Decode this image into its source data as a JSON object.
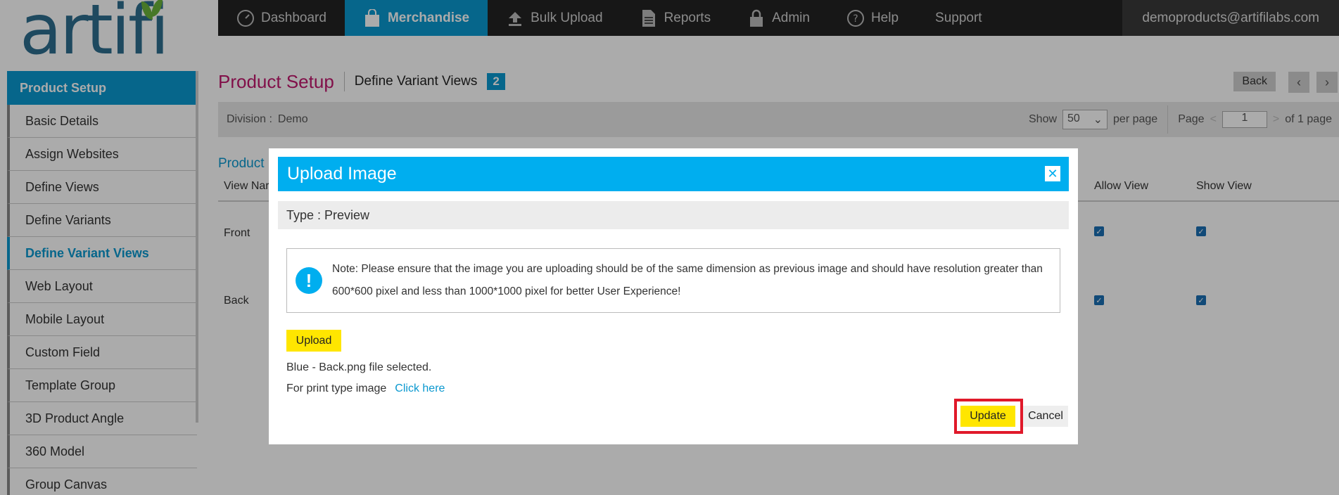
{
  "logo": {
    "text": "artifi"
  },
  "nav": {
    "items": [
      {
        "label": "Dashboard",
        "icon": "dashboard-gauge-icon"
      },
      {
        "label": "Merchandise",
        "icon": "shopping-bag-icon",
        "active": true
      },
      {
        "label": "Bulk Upload",
        "icon": "upload-arrow-icon"
      },
      {
        "label": "Reports",
        "icon": "document-icon"
      },
      {
        "label": "Admin",
        "icon": "lock-icon"
      },
      {
        "label": "Help",
        "icon": "question-icon"
      },
      {
        "label": "Support",
        "icon": ""
      }
    ],
    "user_email": "demoproducts@artifilabs.com"
  },
  "sidebar": {
    "header": "Product Setup",
    "items": [
      {
        "label": "Basic Details"
      },
      {
        "label": "Assign Websites"
      },
      {
        "label": "Define Views"
      },
      {
        "label": "Define Variants"
      },
      {
        "label": "Define Variant Views",
        "active": true
      },
      {
        "label": "Web Layout"
      },
      {
        "label": "Mobile Layout"
      },
      {
        "label": "Custom Field"
      },
      {
        "label": "Template Group"
      },
      {
        "label": "3D Product Angle"
      },
      {
        "label": "360 Model"
      },
      {
        "label": "Group Canvas"
      }
    ]
  },
  "main": {
    "title": "Product Setup",
    "subtitle": "Define Variant Views",
    "count": "2",
    "back_label": "Back",
    "division_label": "Division :",
    "division_value": "Demo",
    "show_label": "Show",
    "show_value": "50",
    "per_page_label": "per page",
    "page_label": "Page",
    "page_value": "1",
    "of_pages": "of 1 page",
    "section_label": "Product I",
    "columns": {
      "view_name": "View Nar",
      "allow_view": "Allow View",
      "show_view": "Show View"
    },
    "rows": [
      {
        "view": "Front",
        "allow": true,
        "show": true
      },
      {
        "view": "Back",
        "allow": true,
        "show": true
      }
    ]
  },
  "modal": {
    "title": "Upload Image",
    "type_label": "Type : Preview",
    "note": "Note: Please ensure that the image you are uploading should be of the same dimension as previous image and should have resolution greater than 600*600 pixel and less than 1000*1000 pixel for better User Experience!",
    "upload_label": "Upload",
    "file_selected": "Blue - Back.png file selected.",
    "print_type_label": "For print type image",
    "click_here": "Click here",
    "update_label": "Update",
    "cancel_label": "Cancel"
  },
  "colors": {
    "accent_blue": "#0a98cf",
    "modal_header": "#00aeef",
    "title_magenta": "#c0186e",
    "button_yellow": "#ffe600",
    "highlight_red": "#e0192a"
  }
}
